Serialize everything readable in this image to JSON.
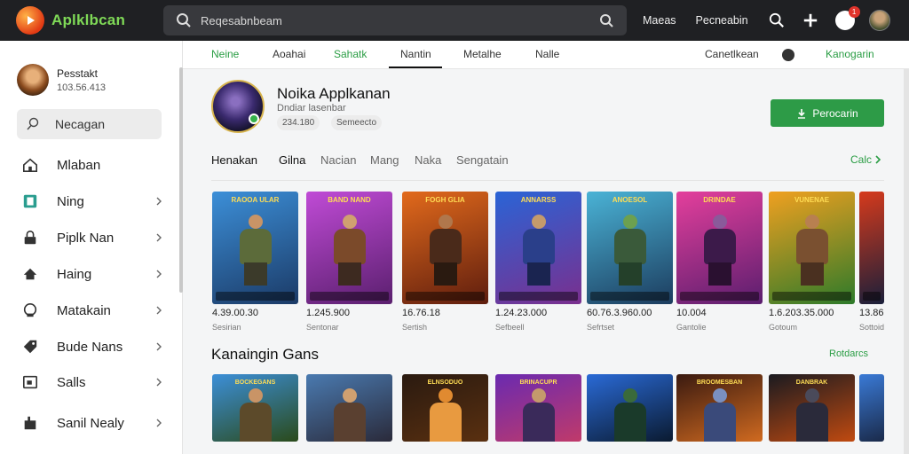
{
  "topbar": {
    "logo_text": "Aplklbcan",
    "search_placeholder": "Reqesabnbeam",
    "link1": "Maeas",
    "link2": "Pecneabin",
    "notif_count": "1"
  },
  "sidebar": {
    "profile_name": "Pesstakt",
    "profile_sub": "103.56.413",
    "search_label": "Necagan",
    "items": [
      {
        "label": "Mlaban",
        "icon": "home-icon",
        "chevron": false
      },
      {
        "label": "Ning",
        "icon": "bookmark-icon",
        "chevron": true
      },
      {
        "label": "Piplk Nan",
        "icon": "lock-icon",
        "chevron": true
      },
      {
        "label": "Haing",
        "icon": "house-icon",
        "chevron": true
      },
      {
        "label": "Matakain",
        "icon": "chat-icon",
        "chevron": true
      },
      {
        "label": "Bude Nans",
        "icon": "tag-icon",
        "chevron": true
      },
      {
        "label": "Salls",
        "icon": "box-icon",
        "chevron": true
      },
      {
        "label": "Sanil Nealy",
        "icon": "shop-icon",
        "chevron": true
      }
    ]
  },
  "tabs": [
    "Neine",
    "Aoahai",
    "Sahatk",
    "Nantin",
    "Metalhe",
    "Nalle",
    "Canetlkean",
    "Kanogarin"
  ],
  "app": {
    "title": "Noika Applkanan",
    "subtitle": "Dndiar lasenbar",
    "pill1": "234.180",
    "pill2": "Semeecto",
    "install_label": "Perocarin"
  },
  "categories": [
    "Henakan",
    "Gilna",
    "Nacian",
    "Mang",
    "Naka",
    "Sengatain"
  ],
  "see_all": "Calc",
  "games_row1": [
    {
      "title": "RAOOA ULAR",
      "num": "4.39.00.30",
      "cat": "Sesirian"
    },
    {
      "title": "BAND NAND",
      "num": "1.245.900",
      "cat": "Sentonar"
    },
    {
      "title": "FOGH GLIA",
      "num": "16.76.18",
      "cat": "Sertish"
    },
    {
      "title": "ANNARSS",
      "num": "1.24.23.000",
      "cat": "Sefbeell"
    },
    {
      "title": "ANOESOL",
      "num": "60.76.3.960.00",
      "cat": "Sefrtset"
    },
    {
      "title": "DRINDAE",
      "num": "10.004",
      "cat": "Gantolie"
    },
    {
      "title": "VUNENAE",
      "num": "1.6.203.35.000",
      "cat": "Gotoum"
    },
    {
      "title": "NSRN",
      "num": "13.86",
      "cat": "Sottoid"
    }
  ],
  "section2": {
    "title": "Kanaingin Gans",
    "link": "Rotdarcs"
  },
  "games_row2": [
    {
      "title": "BOCKEGANS"
    },
    {
      "title": ""
    },
    {
      "title": "ELNSODUO"
    },
    {
      "title": "BRINACUPR"
    },
    {
      "title": ""
    },
    {
      "title": "BROOMESBAN"
    },
    {
      "title": "DANBRAK"
    },
    {
      "title": ""
    }
  ],
  "colors": {
    "accent": "#2d9b47",
    "topbar": "#1f2023"
  }
}
